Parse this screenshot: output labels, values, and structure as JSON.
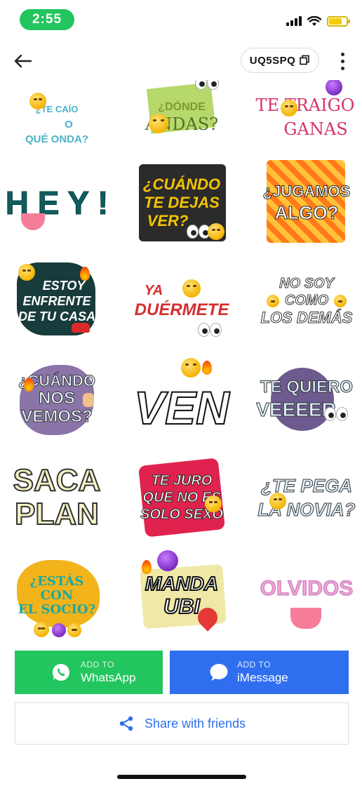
{
  "status_bar": {
    "time": "2:55",
    "battery_level": 0.75,
    "accent": "#22c55e"
  },
  "header": {
    "code": "UQ5SPQ"
  },
  "stickers": [
    {
      "lines": [
        "¿TE CAÍO",
        "O",
        "QUÉ ONDA?"
      ],
      "color": "#4ab3c9"
    },
    {
      "lines": [
        "¿DÓNDE",
        "ANDAS?"
      ],
      "color": "#7d9a2e"
    },
    {
      "lines": [
        "TE TRAIGO",
        "GANAS"
      ],
      "color": "#d6336c"
    },
    {
      "lines": [
        "H E Y !"
      ],
      "color": "#0f5d5e"
    },
    {
      "lines": [
        "¿CUÁNDO",
        "TE DEJAS",
        "VER?"
      ],
      "color": "#f5c400"
    },
    {
      "lines": [
        "¿JUGAMOS",
        "ALGO?"
      ],
      "color": "#ffffff"
    },
    {
      "lines": [
        "ESTOY",
        "ENFRENTE",
        "DE TU CASA"
      ],
      "color": "#ffffff"
    },
    {
      "lines": [
        "YA",
        "DUÉRMETE"
      ],
      "color": "#d32f2f"
    },
    {
      "lines": [
        "NO SOY",
        "COMO",
        "LOS DEMÁS"
      ],
      "color": "#ffffff"
    },
    {
      "lines": [
        "¿CUÁNDO",
        "NOS",
        "VEMOS?"
      ],
      "color": "#e8f7ff"
    },
    {
      "lines": [
        "VEN"
      ],
      "color": "#ffffff"
    },
    {
      "lines": [
        "TE QUIERO",
        "VEEEER"
      ],
      "color": "#dff3ff"
    },
    {
      "lines": [
        "SACA",
        "PLAN"
      ],
      "color": "#f7f2c6"
    },
    {
      "lines": [
        "TE JURO",
        "QUE NO ES",
        "SOLO SEXO"
      ],
      "color": "#ffffff"
    },
    {
      "lines": [
        "¿TE PEGA",
        "LA NOVIA?"
      ],
      "color": "#dff3ff"
    },
    {
      "lines": [
        "¿ESTÁS",
        "CON",
        "EL SOCIO?"
      ],
      "color": "#1aa9a3"
    },
    {
      "lines": [
        "MANDA",
        "UBI"
      ],
      "color": "#ffffff"
    },
    {
      "lines": [
        "OLVIDOS"
      ],
      "color": "#f0a6d8"
    }
  ],
  "actions": {
    "whatsapp": {
      "small": "ADD TO",
      "big": "WhatsApp",
      "color": "#22c55e"
    },
    "imessage": {
      "small": "ADD TO",
      "big": "iMessage",
      "color": "#2f6fef"
    },
    "share": {
      "label": "Share with friends"
    }
  }
}
